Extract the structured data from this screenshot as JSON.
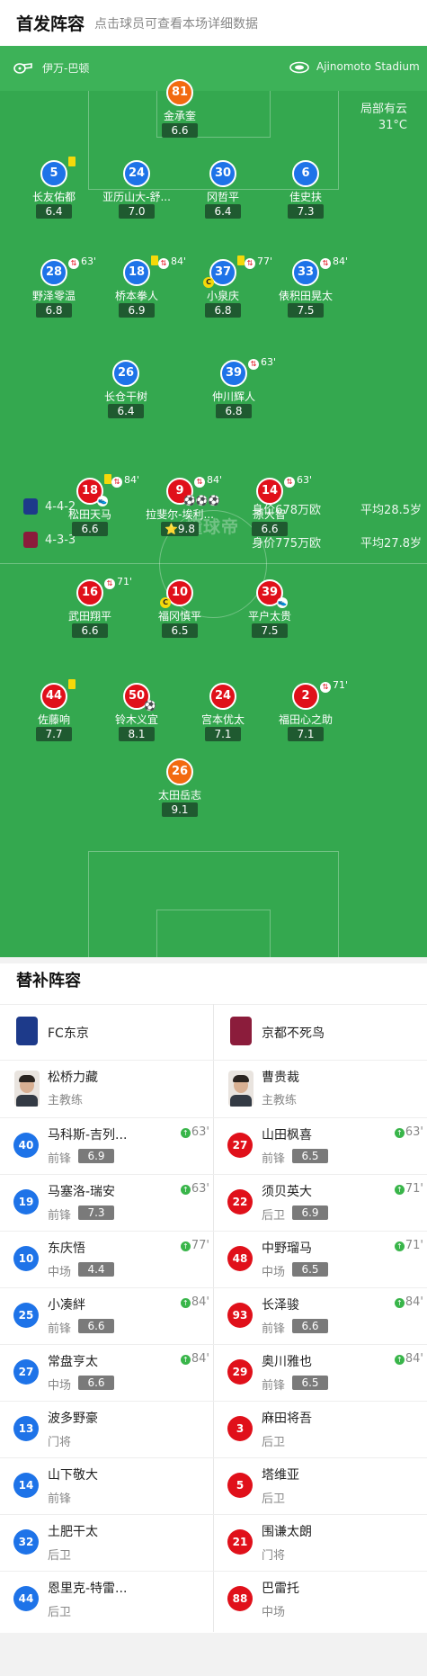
{
  "header": {
    "title": "首发阵容",
    "subtitle": "点击球员可查看本场详细数据"
  },
  "match": {
    "referee": "伊万-巴顿",
    "stadium": "Ajinomoto Stadium",
    "weather": "局部有云",
    "temperature": "31°C",
    "watermark": "懂球帝"
  },
  "teams_bar": {
    "home": {
      "formation": "4-4-2",
      "value": "身价678万欧",
      "age": "平均28.5岁",
      "color": "#1d3a8a"
    },
    "away": {
      "formation": "4-3-3",
      "value": "身价775万欧",
      "age": "平均27.8岁",
      "color": "#8b1c3b"
    }
  },
  "pitch_home": [
    {
      "num": "81",
      "name": "金承奎",
      "rating": "6.6",
      "gk": true
    },
    {
      "num": "5",
      "name": "长友佑都",
      "rating": "6.4",
      "yellow": true
    },
    {
      "num": "24",
      "name": "亚历山大-舒...",
      "rating": "7.0"
    },
    {
      "num": "30",
      "name": "冈哲平",
      "rating": "6.4"
    },
    {
      "num": "6",
      "name": "佳史扶",
      "rating": "7.3"
    },
    {
      "num": "28",
      "name": "野泽零温",
      "rating": "6.8",
      "sub": "63'"
    },
    {
      "num": "18",
      "name": "桥本拳人",
      "rating": "6.9",
      "yellow": true,
      "sub": "84'"
    },
    {
      "num": "37",
      "name": "小泉庆",
      "rating": "6.8",
      "yellow": true,
      "sub": "77'",
      "captain": true
    },
    {
      "num": "33",
      "name": "俵积田晃太",
      "rating": "7.5",
      "sub": "84'"
    },
    {
      "num": "26",
      "name": "长仓干树",
      "rating": "6.4"
    },
    {
      "num": "39",
      "name": "仲川辉人",
      "rating": "6.8",
      "sub": "63'"
    }
  ],
  "pitch_away": [
    {
      "num": "18",
      "name": "松田天马",
      "rating": "6.6",
      "yellow": true,
      "sub": "84'",
      "assist": true
    },
    {
      "num": "9",
      "name": "拉斐尔-埃利...",
      "rating": "9.8",
      "sub": "84'",
      "goals": "⚽⚽⚽",
      "star": "⭐"
    },
    {
      "num": "14",
      "name": "原大智",
      "rating": "6.6",
      "sub": "63'"
    },
    {
      "num": "16",
      "name": "武田翔平",
      "rating": "6.6",
      "sub": "71'"
    },
    {
      "num": "10",
      "name": "福冈慎平",
      "rating": "6.5",
      "captain": true
    },
    {
      "num": "39",
      "name": "平户太贵",
      "rating": "7.5",
      "assist": true
    },
    {
      "num": "44",
      "name": "佐藤响",
      "rating": "7.7",
      "yellow": true
    },
    {
      "num": "50",
      "name": "铃木义宜",
      "rating": "8.1",
      "goals": "⚽"
    },
    {
      "num": "24",
      "name": "宫本优太",
      "rating": "7.1"
    },
    {
      "num": "2",
      "name": "福田心之助",
      "rating": "7.1",
      "sub": "71'"
    },
    {
      "num": "26",
      "name": "太田岳志",
      "rating": "9.1",
      "gk": true
    }
  ],
  "subs": {
    "title": "替补阵容",
    "home": {
      "team": "FC东京",
      "logo_color": "#1d3a8a",
      "coach": {
        "name": "松桥力藏",
        "role": "主教练"
      },
      "players": [
        {
          "num": "40",
          "name": "马科斯-吉列...",
          "pos": "前锋",
          "rating": "6.9",
          "minute": "63'"
        },
        {
          "num": "19",
          "name": "马塞洛-瑞安",
          "pos": "前锋",
          "rating": "7.3",
          "minute": "63'"
        },
        {
          "num": "10",
          "name": "东庆悟",
          "pos": "中场",
          "rating": "4.4",
          "minute": "77'"
        },
        {
          "num": "25",
          "name": "小凑絆",
          "pos": "前锋",
          "rating": "6.6",
          "minute": "84'"
        },
        {
          "num": "27",
          "name": "常盘亨太",
          "pos": "中场",
          "rating": "6.6",
          "minute": "84'"
        },
        {
          "num": "13",
          "name": "波多野豪",
          "pos": "门将"
        },
        {
          "num": "14",
          "name": "山下敬大",
          "pos": "前锋"
        },
        {
          "num": "32",
          "name": "土肥干太",
          "pos": "后卫"
        },
        {
          "num": "44",
          "name": "恩里克-特雷...",
          "pos": "后卫"
        }
      ]
    },
    "away": {
      "team": "京都不死鸟",
      "logo_color": "#8b1c3b",
      "coach": {
        "name": "曹贵裁",
        "role": "主教练"
      },
      "players": [
        {
          "num": "27",
          "name": "山田枫喜",
          "pos": "前锋",
          "rating": "6.5",
          "minute": "63'"
        },
        {
          "num": "22",
          "name": "须贝英大",
          "pos": "后卫",
          "rating": "6.9",
          "minute": "71'"
        },
        {
          "num": "48",
          "name": "中野瑠马",
          "pos": "中场",
          "rating": "6.5",
          "minute": "71'"
        },
        {
          "num": "93",
          "name": "长泽骏",
          "pos": "前锋",
          "rating": "6.6",
          "minute": "84'"
        },
        {
          "num": "29",
          "name": "奥川雅也",
          "pos": "前锋",
          "rating": "6.5",
          "minute": "84'"
        },
        {
          "num": "3",
          "name": "麻田将吾",
          "pos": "后卫"
        },
        {
          "num": "5",
          "name": "塔维亚",
          "pos": "后卫"
        },
        {
          "num": "21",
          "name": "围谦太朗",
          "pos": "门将"
        },
        {
          "num": "88",
          "name": "巴雷托",
          "pos": "中场"
        }
      ]
    }
  }
}
